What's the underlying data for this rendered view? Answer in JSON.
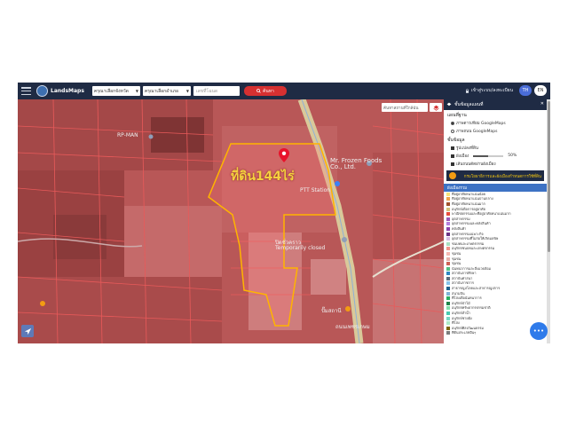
{
  "app": {
    "brand": "LandsMaps"
  },
  "topbar": {
    "province_select": "ครุณาเลือกจังหวัด",
    "district_select": "ครุณาเลือกอำเภอ",
    "parcel_placeholder": "เลขที่โฉนด",
    "search_label": "ค้นหา",
    "login_label": "เข้าสู่ระบบ/ลงทะเบียน",
    "lang_th": "TH",
    "lang_en": "EN"
  },
  "map": {
    "search_placeholder": "ค้นหาสถานที่ใกล้ฉัน",
    "highlight_label": "ที่ดิน144ไร่",
    "road_label": "ถนนเพชรเกษม",
    "places": [
      {
        "name": "RP-MAN"
      },
      {
        "name": "Mr. Frozen Foods Co., Ltd."
      },
      {
        "name": "PTT Station"
      },
      {
        "name": "Temporarily closed"
      },
      {
        "name": "ปิดชั่วคราว"
      },
      {
        "name": "ปั๊มสถานี"
      }
    ]
  },
  "panel": {
    "title": "ชั้นข้อมูลแผนที่",
    "basemap_title": "แผนที่ฐาน",
    "basemaps": [
      {
        "label": "ภาพดาวเทียม GoogleMaps",
        "selected": true
      },
      {
        "label": "ภาพถนน GoogleMaps",
        "selected": false
      }
    ],
    "layers_title": "ชั้นข้อมูล",
    "layers": [
      {
        "label": "รูปแปลงที่ดิน"
      },
      {
        "label": "ผังเมือง",
        "value": "50%"
      },
      {
        "label": "เส้นถนนตัดผ่านผังเมือง"
      }
    ],
    "banner_text": "กรมโยธาธิการและผังเมืองกำหนดการใช้ที่ดิน",
    "legend_title": "ผังเมืองรวม",
    "legend": [
      {
        "label": "ที่อยู่อาศัยหนาแน่นน้อย",
        "color": "#f6e27a"
      },
      {
        "label": "ที่อยู่อาศัยหนาแน่นปานกลาง",
        "color": "#f0a34a"
      },
      {
        "label": "ที่อยู่อาศัยหนาแน่นมาก",
        "color": "#a0522d"
      },
      {
        "label": "อนุรักษ์เพื่อการอยู่อาศัย",
        "color": "#d4c17a"
      },
      {
        "label": "พาณิชยกรรมและที่อยู่อาศัยหนาแน่นมาก",
        "color": "#e74c3c"
      },
      {
        "label": "อุตสาหกรรม",
        "color": "#9b59b6"
      },
      {
        "label": "อุตสาหกรรมและคลังสินค้า",
        "color": "#b57edc"
      },
      {
        "label": "คลังสินค้า",
        "color": "#8e44ad"
      },
      {
        "label": "อุตสาหกรรมเฉพาะกิจ",
        "color": "#6c3483"
      },
      {
        "label": "อุตสาหกรรมที่ไม่ก่อให้เกิดมลพิษ",
        "color": "#d7bde2"
      },
      {
        "label": "ชนบทและเกษตรกรรม",
        "color": "#a9dfbf"
      },
      {
        "label": "อนุรักษ์ชนบทและเกษตรกรรม",
        "color": "#f1948a"
      },
      {
        "label": "ชุมชน",
        "color": "#f5b7b1"
      },
      {
        "label": "ชุมชน",
        "color": "#e6b0aa"
      },
      {
        "label": "ชุมชน",
        "color": "#cd6155"
      },
      {
        "label": "นันทนาการและสิ่งแวดล้อม",
        "color": "#52be80"
      },
      {
        "label": "สถาบันการศึกษา",
        "color": "#2e86c1"
      },
      {
        "label": "สถาบันศาสนา",
        "color": "#5d6d7e"
      },
      {
        "label": "สถาบันราชการ",
        "color": "#85c1e9"
      },
      {
        "label": "สาธารณูปโภคและสาธารณูปการ",
        "color": "#1f618d"
      },
      {
        "label": "สนามบิน",
        "color": "#7fb3d5"
      },
      {
        "label": "ที่โล่งเพื่อนันทนาการ",
        "color": "#27ae60"
      },
      {
        "label": "อนุรักษ์ป่าไม้",
        "color": "#1e8449"
      },
      {
        "label": "อนุรักษ์ทรัพยากรธรรมชาติ",
        "color": "#82e0aa"
      },
      {
        "label": "อนุรักษ์ลำน้ำ",
        "color": "#48c9b0"
      },
      {
        "label": "อนุรักษ์ชายฝั่ง",
        "color": "#76d7c4"
      },
      {
        "label": "ที่โล่ง",
        "color": "#abebc6"
      },
      {
        "label": "อนุรักษ์ศิลปวัฒนธรรม",
        "color": "#7d6608"
      },
      {
        "label": "ที่ดินประเภทอื่นๆ",
        "color": "#7b7d7d"
      }
    ]
  },
  "fab": {
    "label": "•••"
  }
}
